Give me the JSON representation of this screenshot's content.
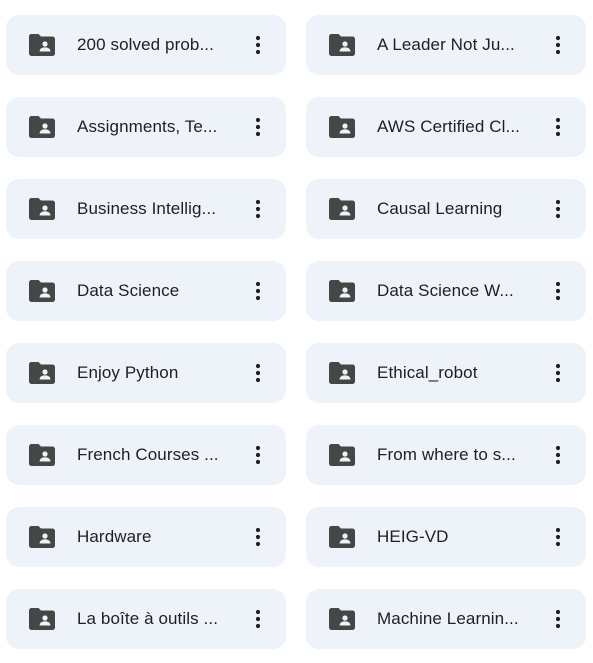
{
  "folders": [
    {
      "label": "200 solved prob...",
      "icon": "shared-folder-icon"
    },
    {
      "label": "A Leader Not Ju...",
      "icon": "shared-folder-icon"
    },
    {
      "label": "Assignments, Te...",
      "icon": "shared-folder-icon"
    },
    {
      "label": "AWS Certified Cl...",
      "icon": "shared-folder-icon"
    },
    {
      "label": "Business Intellig...",
      "icon": "shared-folder-icon"
    },
    {
      "label": "Causal Learning",
      "icon": "shared-folder-icon"
    },
    {
      "label": "Data Science",
      "icon": "shared-folder-icon"
    },
    {
      "label": "Data Science W...",
      "icon": "shared-folder-icon"
    },
    {
      "label": "Enjoy Python",
      "icon": "shared-folder-icon"
    },
    {
      "label": "Ethical_robot",
      "icon": "shared-folder-icon"
    },
    {
      "label": "French Courses ...",
      "icon": "shared-folder-icon"
    },
    {
      "label": "From where to s...",
      "icon": "shared-folder-icon"
    },
    {
      "label": "Hardware",
      "icon": "shared-folder-icon"
    },
    {
      "label": "HEIG-VD",
      "icon": "shared-folder-icon"
    },
    {
      "label": "La boîte à outils ...",
      "icon": "shared-folder-icon"
    },
    {
      "label": "Machine Learnin...",
      "icon": "shared-folder-icon"
    }
  ],
  "more_icon": "more-vertical-icon",
  "colors": {
    "card_background": "#eef2f9",
    "icon": "#444746",
    "text": "#1f1f1f"
  }
}
